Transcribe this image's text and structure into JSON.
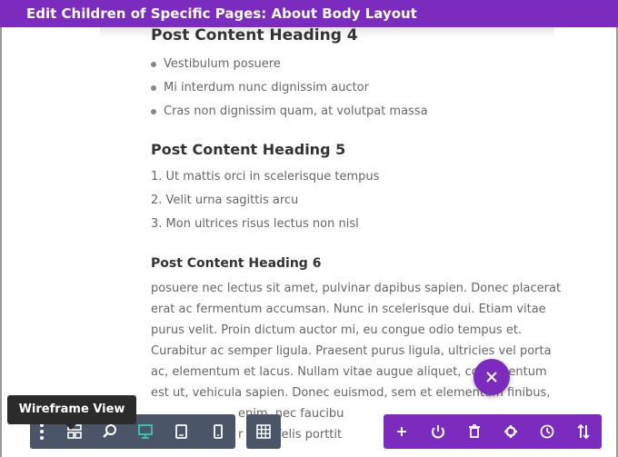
{
  "header": {
    "title": "Edit Children of Specific Pages: About Body Layout"
  },
  "content": {
    "heading4": "Post Content Heading 4",
    "bullets": [
      "Vestibulum posuere",
      "Mi interdum nunc dignissim auctor",
      "Cras non dignissim quam, at volutpat massa"
    ],
    "heading5": "Post Content Heading 5",
    "ordered": [
      "1. Ut mattis orci in scelerisque tempus",
      "2. Velit urna sagittis arcu",
      "3. Mon ultrices risus lectus non nisl"
    ],
    "heading6": "Post Content Heading 6",
    "paragraph_lines": [
      "posuere nec lectus sit amet, pulvinar dapibus sapien. Donec placerat",
      "erat ac fermentum accumsan. Nunc in scelerisque dui. Etiam vitae",
      "purus velit. Proin dictum auctor mi, eu congue odio tempus et.",
      "Curabitur ac semper ligula. Praesent purus ligula, ultricies vel porta",
      "ac, elementum et lacus. Nullam vitae augue aliquet, condimentum",
      "est ut, vehicula sapien. Donec euismod, sem et elementum finibus,",
      "enim, nec faucibu",
      "r eget felis porttit"
    ]
  },
  "fab": {
    "icon": "close-icon"
  },
  "tooltip": {
    "text": "Wireframe View"
  },
  "toolbar_left": {
    "buttons": [
      {
        "icon": "more-vertical-icon"
      },
      {
        "icon": "wireframe-icon"
      },
      {
        "icon": "zoom-icon"
      },
      {
        "icon": "desktop-icon",
        "active": true
      },
      {
        "icon": "tablet-icon"
      },
      {
        "icon": "phone-icon"
      }
    ]
  },
  "toolbar_grid": {
    "icon": "grid-icon"
  },
  "toolbar_right": {
    "buttons": [
      {
        "icon": "add-icon"
      },
      {
        "icon": "power-icon"
      },
      {
        "icon": "trash-icon"
      },
      {
        "icon": "settings-icon"
      },
      {
        "icon": "history-icon"
      },
      {
        "icon": "sort-icon"
      }
    ]
  },
  "colors": {
    "accent": "#7b2cbf",
    "toolbar": "#4a5668",
    "active": "#3dc7b8"
  }
}
